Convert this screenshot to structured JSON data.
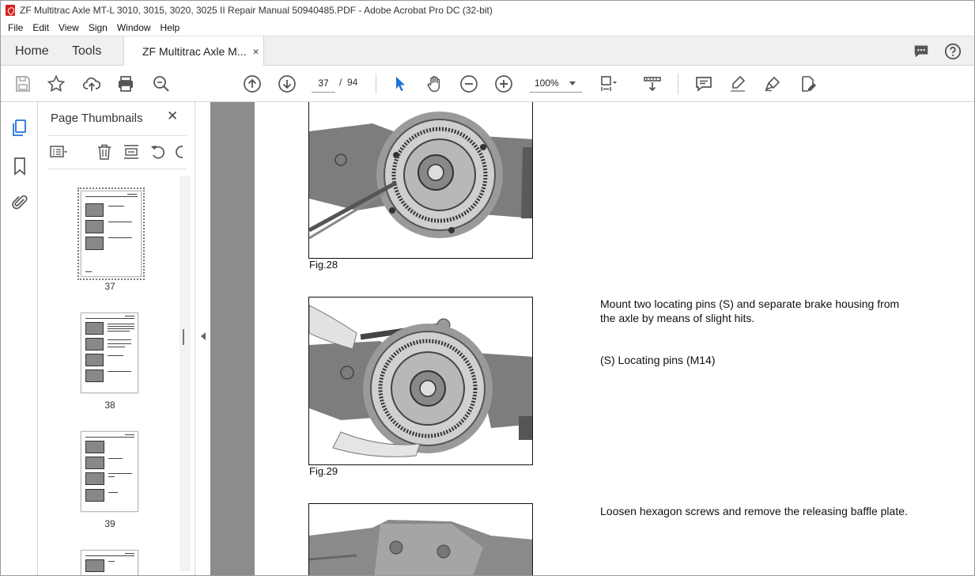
{
  "window": {
    "title": "ZF Multitrac Axle MT-L 3010, 3015, 3020, 3025 II Repair Manual 50940485.PDF - Adobe Acrobat Pro DC (32-bit)"
  },
  "menu": [
    "File",
    "Edit",
    "View",
    "Sign",
    "Window",
    "Help"
  ],
  "tabs": {
    "home": "Home",
    "tools": "Tools",
    "document": "ZF Multitrac Axle M...",
    "close": "×"
  },
  "toolbar": {
    "current_page": "37",
    "page_separator": "/",
    "total_pages": "94",
    "zoom": "100%"
  },
  "thumbnails": {
    "title": "Page Thumbnails",
    "close": "✕",
    "pages": [
      {
        "number": "37",
        "selected": true
      },
      {
        "number": "38",
        "selected": false
      },
      {
        "number": "39",
        "selected": false
      }
    ]
  },
  "document": {
    "fig28_caption": "Fig.28",
    "fig29_caption": "Fig.29",
    "fig29_text": "Mount two locating pins (S) and separate brake housing from the axle by means of slight hits.",
    "fig29_note": "(S) Locating pins (M14)",
    "fig30_text": "Loosen hexagon screws and remove the releasing baffle plate."
  },
  "colors": {
    "accent": "#1e73d6",
    "app_red": "#d6201f",
    "doc_background": "#8c8c8c"
  }
}
